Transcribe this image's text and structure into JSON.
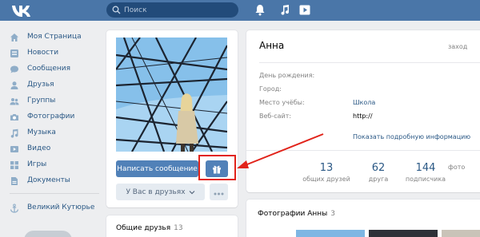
{
  "header": {
    "logo": "vk-logo",
    "search": {
      "placeholder": "Поиск",
      "value": ""
    },
    "icons": [
      "bell-icon",
      "music-icon",
      "play-icon"
    ],
    "background": "#4a76a8"
  },
  "sidebar": {
    "items": [
      {
        "label": "Моя Страница",
        "icon": "home-icon"
      },
      {
        "label": "Новости",
        "icon": "news-icon"
      },
      {
        "label": "Сообщения",
        "icon": "messages-icon"
      },
      {
        "label": "Друзья",
        "icon": "friends-icon"
      },
      {
        "label": "Группы",
        "icon": "groups-icon"
      },
      {
        "label": "Фотографии",
        "icon": "camera-icon"
      },
      {
        "label": "Музыка",
        "icon": "music-icon"
      },
      {
        "label": "Видео",
        "icon": "video-icon"
      },
      {
        "label": "Игры",
        "icon": "games-icon"
      },
      {
        "label": "Документы",
        "icon": "documents-icon"
      }
    ],
    "extra": {
      "label": "Великий Кутюрье",
      "icon": "anchor-icon"
    }
  },
  "profile": {
    "write_message": "Написать сообщение",
    "gift_icon": "gift-icon",
    "friends_status": "У Вас в друзьях",
    "more_icon": "more-icon",
    "mutual_friends": {
      "label": "Общие друзья",
      "count": "13"
    }
  },
  "info": {
    "name": "Анна",
    "status": "заход",
    "rows": [
      {
        "label": "День рождения:",
        "value": ""
      },
      {
        "label": "Город:",
        "value": ""
      },
      {
        "label": "Место учёбы:",
        "value": "Школа"
      },
      {
        "label": "Веб-сайт:",
        "value": "http://"
      }
    ],
    "more_info": "Показать подробную информацию",
    "stats": [
      {
        "num": "13",
        "label": "общих друзей"
      },
      {
        "num": "62",
        "label": "друга"
      },
      {
        "num": "144",
        "label": "подписчика"
      },
      {
        "num": "",
        "label": "фото"
      }
    ]
  },
  "photos": {
    "title": "Фотографии Анны",
    "count": "3"
  },
  "annotation": {
    "color": "#e1231a"
  },
  "colors": {
    "accent": "#5181b8",
    "link": "#2a5885",
    "muted": "#828282"
  }
}
